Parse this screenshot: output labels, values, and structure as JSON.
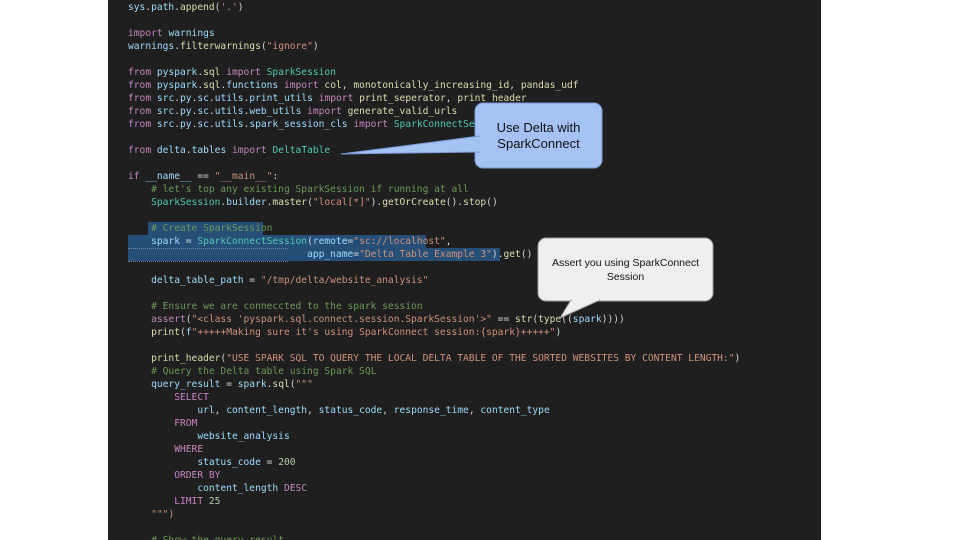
{
  "editor": {
    "lines": [
      "sys.path.append('.')",
      "import warnings",
      "warnings.filterwarnings(\"ignore\")",
      "from pyspark.sql import SparkSession",
      "from pyspark.sql.functions import col, monotonically_increasing_id, pandas_udf",
      "from src.py.sc.utils.print_utils import print_seperator, print_header",
      "from src.py.sc.utils.web_utils import generate_valid_urls",
      "from src.py.sc.utils.spark_session_cls import SparkConnectSession",
      "from delta.tables import DeltaTable",
      "if __name__ == \"__main__\":",
      "    # let's top any existing SparkSession if running at all",
      "    SparkSession.builder.master(\"local[*]\").getOrCreate().stop()",
      "    # Create SparkSession",
      "    spark = SparkConnectSession(remote=\"sc://localhost\",",
      "                               app_name=\"Delta Table Example 3\").get()",
      "    delta_table_path = \"/tmp/delta/website_analysis\"",
      "    # Ensure we are conneccted to the spark session",
      "    assert(\"<class 'pyspark.sql.connect.session.SparkSession'>\" == str(type((spark))))",
      "    print(f\"+++++Making sure it's using SparkConnect session:{spark}+++++\")",
      "    print_header(\"USE SPARK SQL TO QUERY THE LOCAL DELTA TABLE OF THE SORTED WEBSITES BY CONTENT LENGTH:\")",
      "    # Query the Delta table using Spark SQL",
      "    query_result = spark.sql(\"\"\"",
      "        SELECT",
      "            url, content_length, status_code, response_time, content_type",
      "        FROM",
      "            website_analysis",
      "        WHERE",
      "            status_code = 200",
      "        ORDER BY",
      "            content_length DESC",
      "        LIMIT 25",
      "    \"\"\")",
      "    # Show the query result"
    ]
  },
  "callouts": {
    "delta": "Use Delta with SparkConnect",
    "assert": "Assert you using SparkConnect Session"
  },
  "colors": {
    "editor_bg": "#1f1f1f",
    "keyword": "#c586c0",
    "function": "#dcdcaa",
    "string": "#ce9178",
    "comment": "#6a9955",
    "variable": "#9cdcfe",
    "class": "#4ec9b0",
    "selection": "#264f78",
    "callout_blue": "#a4c2f4",
    "callout_grey": "#efefef"
  }
}
